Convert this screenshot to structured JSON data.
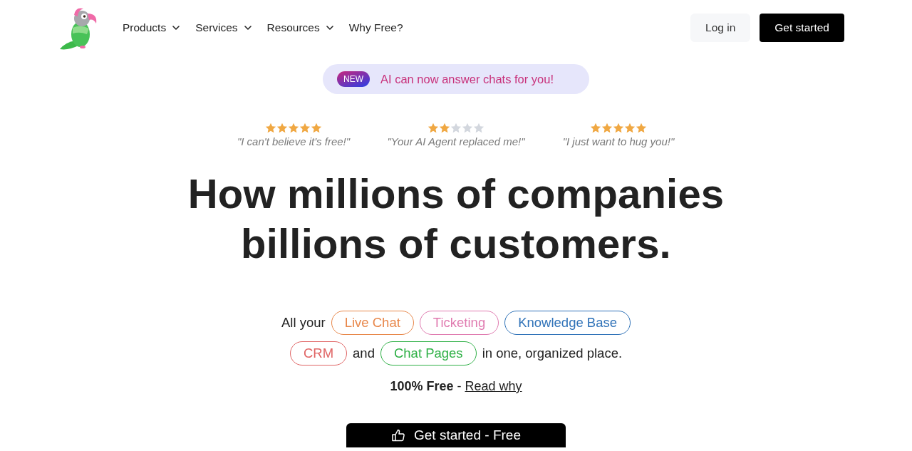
{
  "nav": {
    "links": [
      {
        "label": "Products",
        "has_menu": true
      },
      {
        "label": "Services",
        "has_menu": true
      },
      {
        "label": "Resources",
        "has_menu": true
      },
      {
        "label": "Why Free?",
        "has_menu": false
      }
    ],
    "login": "Log in",
    "cta": "Get started"
  },
  "announcement": {
    "badge": "NEW",
    "text": "AI can now answer chats for you!"
  },
  "reviews": [
    {
      "stars": 5,
      "quote": "\"I can't believe it's free!\""
    },
    {
      "stars": 2,
      "quote": "\"Your AI Agent replaced me!\""
    },
    {
      "stars": 5,
      "quote": "\"I just want to hug you!\""
    }
  ],
  "headline": "How millions of companies billions of customers.",
  "features": [
    [
      {
        "kind": "text",
        "text": "All your"
      },
      {
        "kind": "tag",
        "text": "Live Chat",
        "color": "#e8874a"
      },
      {
        "kind": "tag",
        "text": "Ticketing",
        "color": "#e07bb0"
      },
      {
        "kind": "tag",
        "text": "Knowledge Base",
        "color": "#2f72b8"
      }
    ],
    [
      {
        "kind": "tag",
        "text": "CRM",
        "color": "#e06464"
      },
      {
        "kind": "text",
        "text": "and"
      },
      {
        "kind": "tag",
        "text": "Chat Pages",
        "color": "#2fb046"
      },
      {
        "kind": "text",
        "text": "in one, organized place."
      }
    ]
  ],
  "pricing": {
    "text": "**100% Free** -",
    "link": "Read why"
  },
  "cta_button": "Get started - Free"
}
